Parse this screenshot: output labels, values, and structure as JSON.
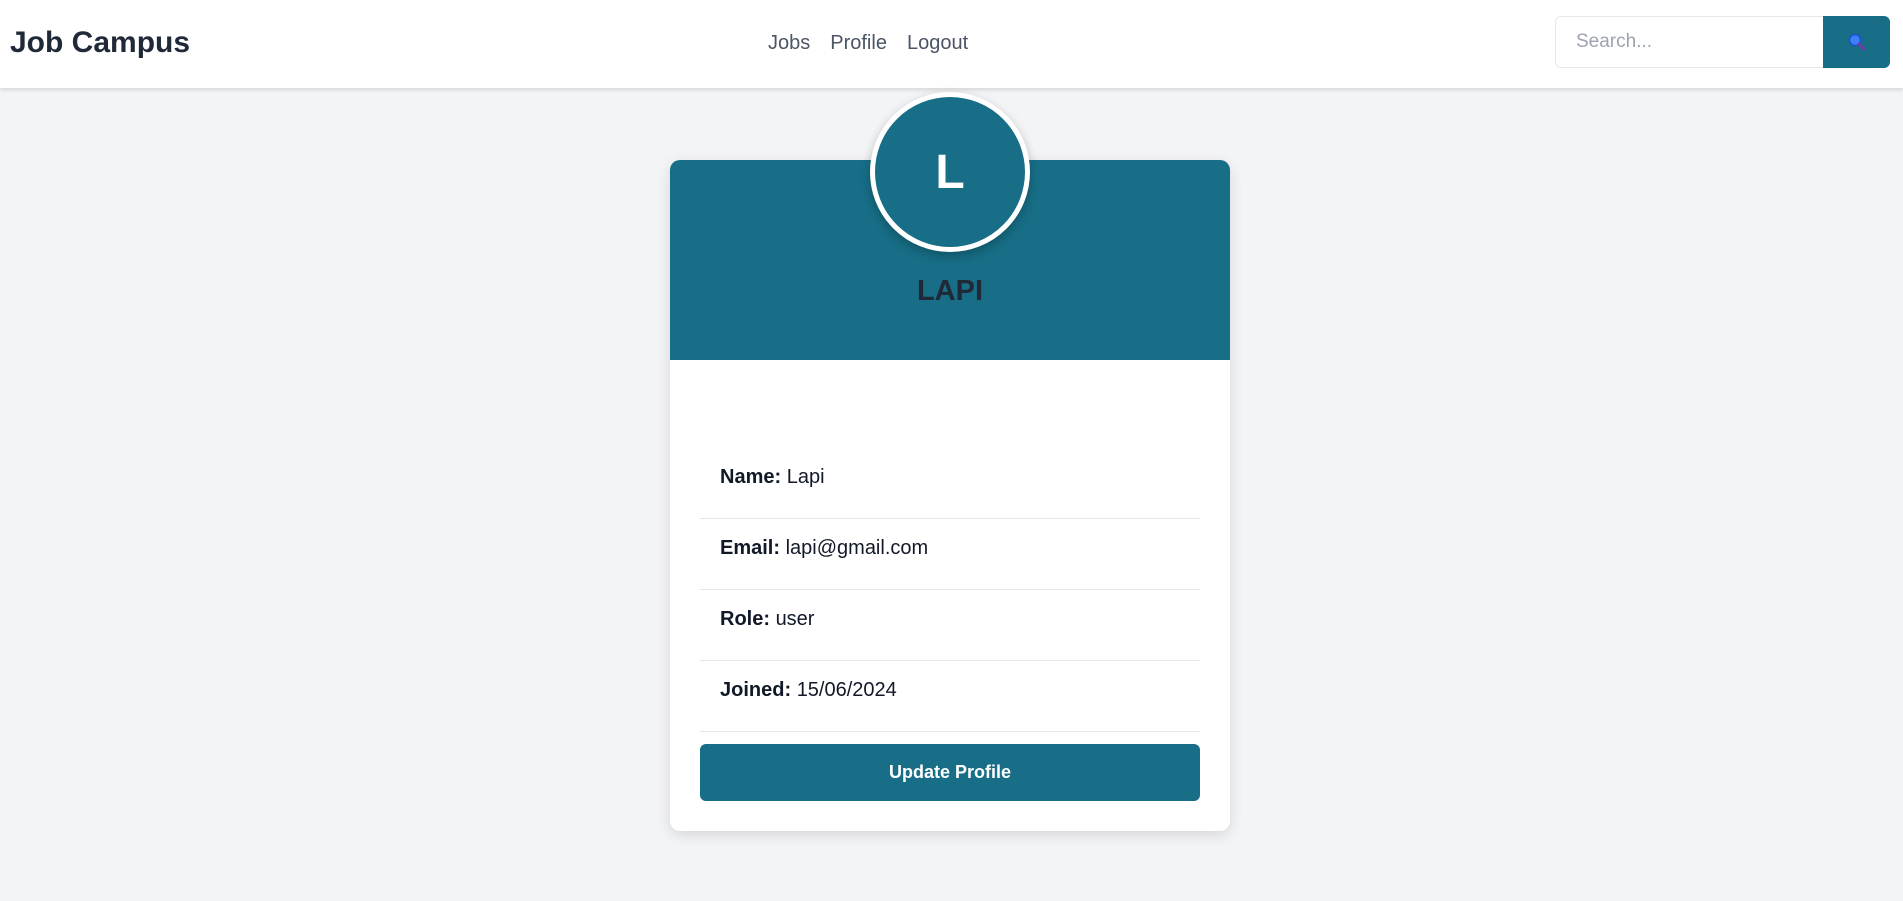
{
  "navbar": {
    "brand": "Job Campus",
    "links": [
      "Jobs",
      "Profile",
      "Logout"
    ],
    "search": {
      "placeholder": "Search...",
      "value": "",
      "button_icon": "search-icon"
    }
  },
  "profile": {
    "avatar_initial": "L",
    "display_name": "LAPI",
    "fields": [
      {
        "label": "Name:",
        "value": "Lapi"
      },
      {
        "label": "Email:",
        "value": "lapi@gmail.com"
      },
      {
        "label": "Role:",
        "value": "user"
      },
      {
        "label": "Joined:",
        "value": "15/06/2024"
      }
    ],
    "update_button": "Update Profile"
  },
  "colors": {
    "accent": "#176e86",
    "background": "#f3f4f6",
    "text": "#1f2937"
  }
}
